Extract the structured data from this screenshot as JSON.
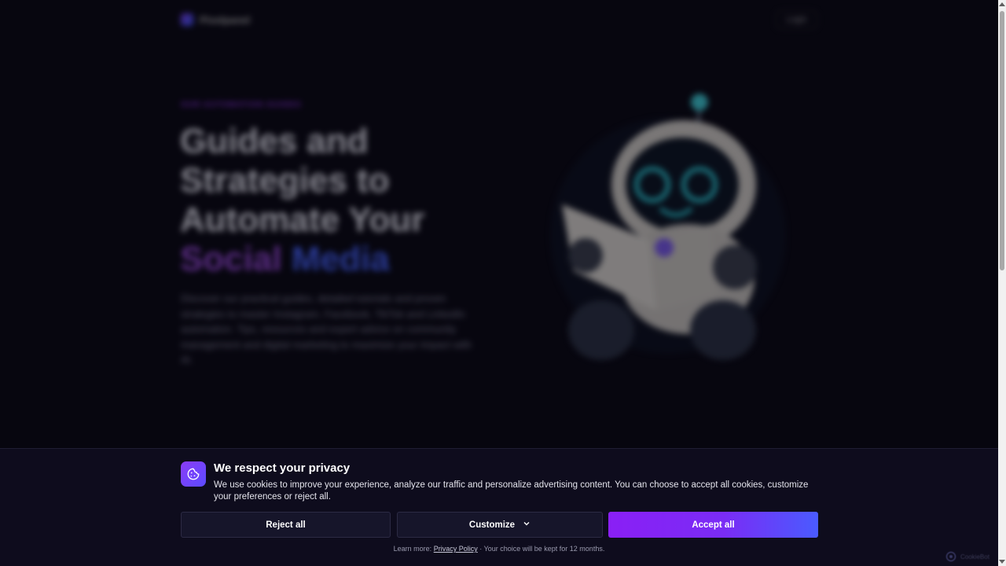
{
  "nav": {
    "logo_text": "Pixelpanel",
    "login_label": "Login"
  },
  "hero": {
    "eyebrow": "Our Automation Guides",
    "title_lines": [
      "Guides and",
      "Strategies to",
      "Automate Your"
    ],
    "title_highlight_1": "Social",
    "title_highlight_2": "Media",
    "description": "Discover our practical guides, detailed tutorials and proven strategies to master Instagram, Facebook, TikTok and LinkedIn automation. Tips, resources and expert advice on community management and digital marketing to maximize your impact with AI."
  },
  "cookie": {
    "title": "We respect your privacy",
    "text": "We use cookies to improve your experience, analyze our traffic and personalize advertising content. You can choose to accept all cookies, customize your preferences or reject all.",
    "reject_label": "Reject all",
    "customize_label": "Customize",
    "accept_label": "Accept all",
    "footer_prefix": "Learn more:",
    "privacy_link": "Privacy Policy",
    "footer_suffix": "· Your choice will be kept for 12 months.",
    "brand": "CookieBot"
  },
  "colors": {
    "accent_start": "#8a1ff5",
    "accent_end": "#4a5bff",
    "banner_bg": "#0e0c1d",
    "page_bg": "#07060f"
  },
  "icons": {
    "cookie": "cookie-icon",
    "chevron": "chevron-down-icon",
    "robot": "robot-mascot-illustration"
  }
}
